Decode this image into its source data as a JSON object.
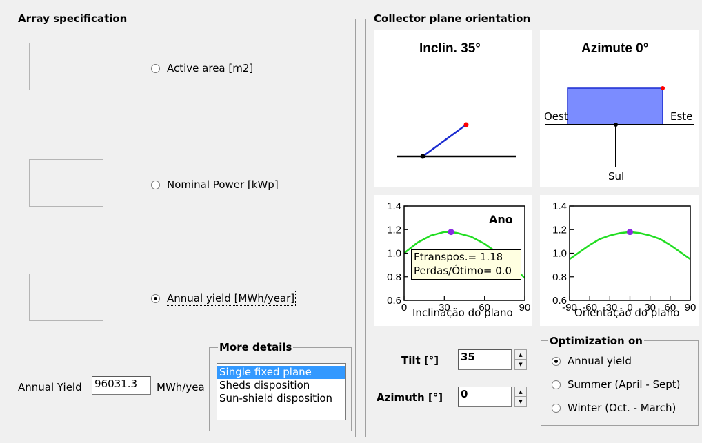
{
  "array_spec": {
    "title": "Array specification",
    "options": [
      {
        "label": "Active area [m2]",
        "selected": false
      },
      {
        "label": "Nominal Power [kWp]",
        "selected": false
      },
      {
        "label": "Annual yield [MWh/year]",
        "selected": true
      }
    ],
    "annual_yield_label": "Annual Yield",
    "annual_yield_value": "96031.3",
    "annual_yield_unit": "MWh/yea"
  },
  "more_details": {
    "title": "More details",
    "items": [
      {
        "label": "Single fixed plane",
        "selected": true
      },
      {
        "label": "Sheds disposition",
        "selected": false
      },
      {
        "label": "Sun-shield disposition",
        "selected": false
      }
    ]
  },
  "collector": {
    "title": "Collector plane orientation",
    "tilt_title": "Inclin. 35°",
    "azimuth_title": "Azimute 0°",
    "west_label": "Oest",
    "east_label": "Este",
    "south_label": "Sul",
    "tilt_label": "Tilt [°]",
    "tilt_value": "35",
    "azimuth_label": "Azimuth [°]",
    "azimuth_value": "0"
  },
  "optimization": {
    "title": "Optimization on",
    "options": [
      {
        "label": "Annual yield",
        "selected": true
      },
      {
        "label": "Summer (April - Sept)",
        "selected": false
      },
      {
        "label": "Winter (Oct. - March)",
        "selected": false
      }
    ]
  },
  "tooltip": {
    "line1": "Ftranspos.= 1.18",
    "line2": "Perdas/Ótimo= 0.0"
  },
  "colors": {
    "curve": "#22dd22",
    "marker": "#8a2be2",
    "plane_fill": "#7b8cff",
    "plane_line": "#1a2bd0",
    "tip": "#ff0000"
  },
  "chart_data": [
    {
      "type": "line",
      "title": "Ano",
      "xlabel": "Inclinação do plano",
      "ylabel": "",
      "xlim": [
        0,
        90
      ],
      "ylim": [
        0.6,
        1.4
      ],
      "xticks": [
        "0",
        "30",
        "60",
        "90"
      ],
      "yticks": [
        "0.6",
        "0.8",
        "1.0",
        "1.2",
        "1.4"
      ],
      "x": [
        0,
        10,
        20,
        30,
        35,
        40,
        50,
        60,
        70,
        80,
        90
      ],
      "y": [
        1.0,
        1.09,
        1.15,
        1.18,
        1.18,
        1.17,
        1.14,
        1.08,
        1.0,
        0.9,
        0.79
      ],
      "marker": {
        "x": 35,
        "y": 1.18
      }
    },
    {
      "type": "line",
      "title": "",
      "xlabel": "Orientação do plano",
      "ylabel": "",
      "xlim": [
        -90,
        90
      ],
      "ylim": [
        0.6,
        1.4
      ],
      "xticks": [
        "-90",
        "-60",
        "-30",
        "0",
        "30",
        "60",
        "90"
      ],
      "yticks": [
        "0.6",
        "0.8",
        "1.0",
        "1.2",
        "1.4"
      ],
      "x": [
        -90,
        -75,
        -60,
        -45,
        -30,
        -15,
        0,
        15,
        30,
        45,
        60,
        75,
        90
      ],
      "y": [
        0.95,
        1.01,
        1.07,
        1.12,
        1.15,
        1.17,
        1.18,
        1.17,
        1.15,
        1.12,
        1.07,
        1.01,
        0.95
      ],
      "marker": {
        "x": 0,
        "y": 1.18
      }
    }
  ]
}
